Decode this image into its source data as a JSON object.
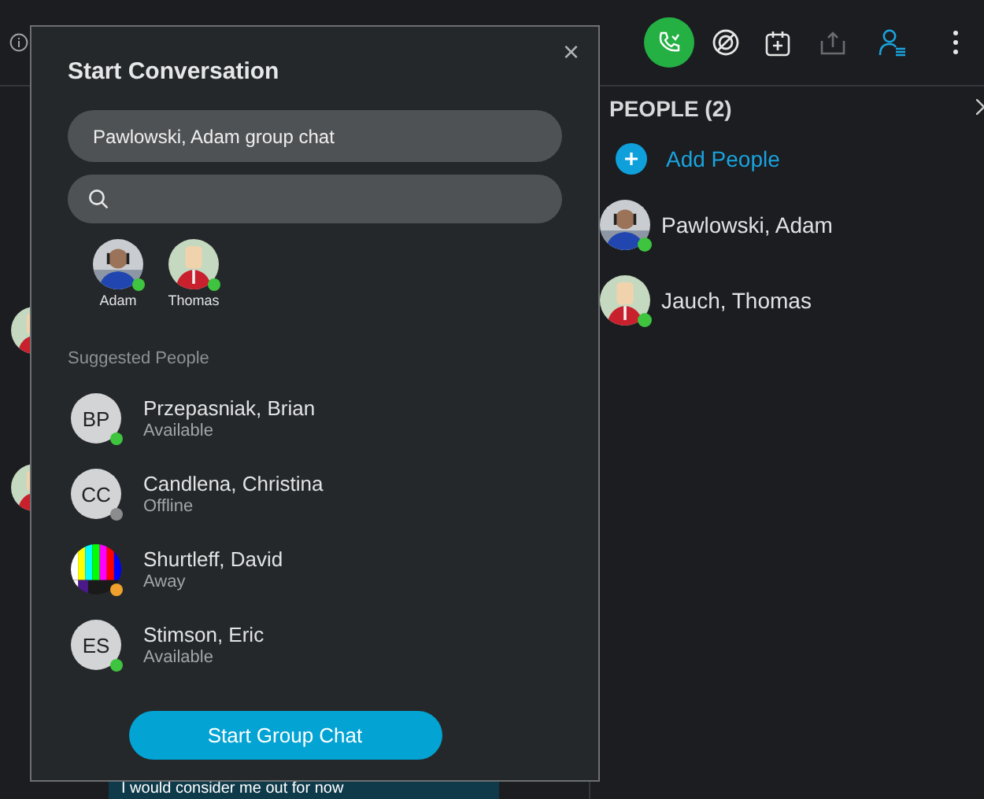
{
  "dialog": {
    "title": "Start Conversation",
    "close": "×",
    "name_field": {
      "value": "Pawlowski, Adam group chat"
    },
    "selected_people": [
      {
        "label": "Adam",
        "color": "#3ec43e"
      },
      {
        "label": "Thomas",
        "kind": "figure",
        "color": "#3ec43e"
      }
    ],
    "suggested_heading": "Suggested People",
    "suggested": [
      {
        "name": "Przepasniak, Brian",
        "status": "Available",
        "kind": "initials",
        "initials": "BP",
        "color": "#3ec43e"
      },
      {
        "name": "Candlena, Christina",
        "status": "Offline",
        "kind": "initials",
        "initials": "CC",
        "color": "#8a8c8e"
      },
      {
        "name": "Shurtleff, David",
        "status": "Away",
        "kind": "bars",
        "color": "#f0a02c"
      },
      {
        "name": "Stimson, Eric",
        "status": "Available",
        "kind": "initials",
        "initials": "ES",
        "color": "#3ec43e"
      }
    ],
    "button": "Start Group Chat"
  },
  "people_panel": {
    "title": "PEOPLE (2)",
    "add": "Add People",
    "people": [
      {
        "name": "Pawlowski, Adam",
        "color": "#3ec43e"
      },
      {
        "name": "Jauch, Thomas",
        "kind": "figure",
        "color": "#3ec43e"
      }
    ]
  },
  "chat": {
    "message": "I would consider me out for now"
  }
}
